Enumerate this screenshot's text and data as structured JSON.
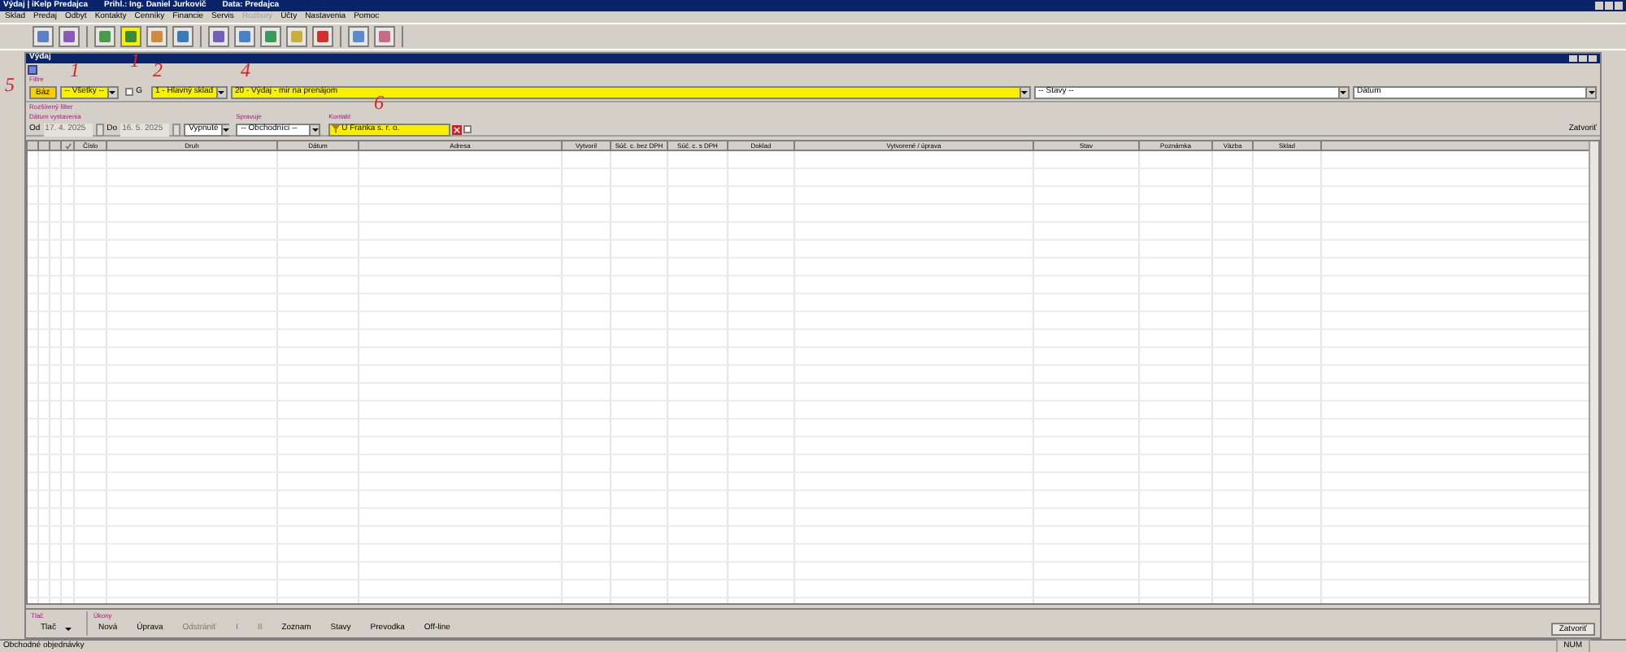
{
  "window": {
    "title": "Výdaj | iKelp Predajca",
    "user": "Prihl.: Ing. Daniel Jurkovič",
    "data": "Data: Predajca"
  },
  "menu": [
    {
      "label": "Sklad",
      "disabled": false
    },
    {
      "label": "Predaj",
      "disabled": false
    },
    {
      "label": "Odbyt",
      "disabled": false
    },
    {
      "label": "Kontakty",
      "disabled": false
    },
    {
      "label": "Cenníky",
      "disabled": false
    },
    {
      "label": "Financie",
      "disabled": false
    },
    {
      "label": "Servis",
      "disabled": false
    },
    {
      "label": "Rozbory",
      "disabled": true
    },
    {
      "label": "Účty",
      "disabled": false
    },
    {
      "label": "Nastavenia",
      "disabled": false
    },
    {
      "label": "Pomoc",
      "disabled": false
    }
  ],
  "toolbar": [
    [
      {
        "color": "#5a7fc8",
        "highlighted": false
      },
      {
        "color": "#8a5ab8",
        "highlighted": false
      }
    ],
    [
      {
        "color": "#4a9a4a",
        "highlighted": false
      },
      {
        "color": "#3a8a3a",
        "highlighted": true
      },
      {
        "color": "#d08a40",
        "highlighted": false
      },
      {
        "color": "#3a7ab8",
        "highlighted": false
      }
    ],
    [
      {
        "color": "#7060b8",
        "highlighted": false
      },
      {
        "color": "#4a80c8",
        "highlighted": false
      },
      {
        "color": "#3a9a5a",
        "highlighted": false
      },
      {
        "color": "#c8b040",
        "highlighted": false
      },
      {
        "color": "#d03030",
        "highlighted": false
      }
    ],
    [
      {
        "color": "#5a8ad0",
        "highlighted": false
      },
      {
        "color": "#c86a8a",
        "highlighted": false
      }
    ]
  ],
  "inner_window": {
    "title": "Výdaj"
  },
  "filters": {
    "label": "Filtre",
    "base_button": {
      "label": "Báz",
      "highlighted": true
    },
    "type_select": {
      "value": "-- Všetky --",
      "highlighted": true
    },
    "g_checkbox": {
      "label": "G",
      "checked": false
    },
    "warehouse_select": {
      "value": "1 - Hlavný sklad",
      "highlighted": true
    },
    "series_select": {
      "value": "20 - Výdaj - mir na prenájom",
      "highlighted": true
    },
    "states_select": {
      "value": "-- Stavy --"
    },
    "sort_select": {
      "value": "Dátum"
    }
  },
  "extended_filter": {
    "label": "Rozšírený filter",
    "date_group": "Dátum vystavenia",
    "from_label": "Od",
    "from": {
      "value": "17. 4. 2025",
      "disabled": true
    },
    "to_label": "Do",
    "to": {
      "value": "16. 5. 2025",
      "disabled": true
    },
    "date_mode": "Vypnuté",
    "manager_label": "Spravuje",
    "manager": "-- Obchodníci --",
    "contact_label": "Kontakt",
    "contact": {
      "value": "U Franka s. r. o.",
      "highlighted": true
    },
    "contact_checkbox": {
      "checked": false
    },
    "close": "Zatvoriť"
  },
  "table": {
    "columns": [
      {
        "label": "Číslo"
      },
      {
        "label": "Druh"
      },
      {
        "label": "Dátum"
      },
      {
        "label": "Adresa"
      },
      {
        "label": "Vytvoril"
      },
      {
        "label": "Súč. c. bez DPH"
      },
      {
        "label": "Súč. c. s DPH"
      },
      {
        "label": "Doklad"
      },
      {
        "label": "Vytvorené / úprava"
      },
      {
        "label": "Stav"
      },
      {
        "label": "Poznámka"
      },
      {
        "label": "Väzba"
      },
      {
        "label": "Sklad"
      }
    ]
  },
  "bottom": {
    "print_group": "Tlač",
    "print_button": "Tlač",
    "actions_group": "Úkony",
    "actions": [
      {
        "label": "Nová",
        "disabled": false
      },
      {
        "label": "Úprava",
        "disabled": false
      },
      {
        "label": "Odstrániť",
        "disabled": true
      },
      {
        "label": "I",
        "disabled": true
      },
      {
        "label": "II",
        "disabled": true
      },
      {
        "label": "Zoznam",
        "disabled": false
      },
      {
        "label": "Stavy",
        "disabled": false
      },
      {
        "label": "Prevodka",
        "disabled": false
      },
      {
        "label": "Off-line",
        "disabled": false
      }
    ],
    "close_button": "Zatvoriť"
  },
  "status_bar": {
    "text": "Obchodné objednávky",
    "num": "NUM"
  },
  "annotations": [
    {
      "text": "1"
    },
    {
      "text": "1"
    },
    {
      "text": "2"
    },
    {
      "text": "4"
    },
    {
      "text": "5"
    },
    {
      "text": "6"
    }
  ]
}
